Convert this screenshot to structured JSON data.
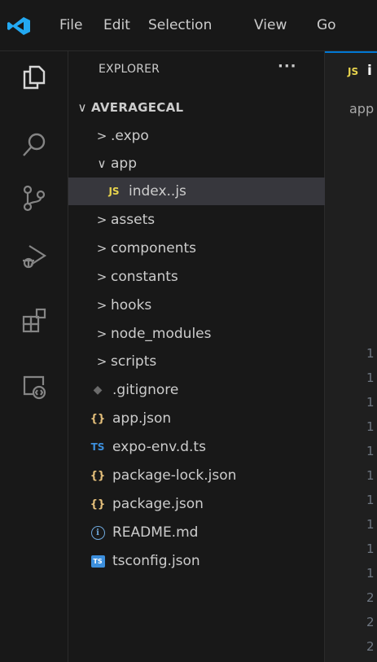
{
  "menu": {
    "items": [
      "File",
      "Edit",
      "Selection",
      "View",
      "Go"
    ]
  },
  "activity": {
    "icons": [
      "explorer-icon",
      "search-icon",
      "source-control-icon",
      "run-debug-icon",
      "extensions-icon",
      "remote-explorer-icon"
    ]
  },
  "sidebar": {
    "title": "EXPLORER",
    "more": "···",
    "root": "AVERAGECAL",
    "items": [
      {
        "label": ".expo",
        "type": "folder",
        "state": "collapsed"
      },
      {
        "label": "app",
        "type": "folder",
        "state": "expanded"
      },
      {
        "label": "index..js",
        "type": "js",
        "badge": "JS",
        "selected": true
      },
      {
        "label": "assets",
        "type": "folder",
        "state": "collapsed"
      },
      {
        "label": "components",
        "type": "folder",
        "state": "collapsed"
      },
      {
        "label": "constants",
        "type": "folder",
        "state": "collapsed"
      },
      {
        "label": "hooks",
        "type": "folder",
        "state": "collapsed"
      },
      {
        "label": "node_modules",
        "type": "folder",
        "state": "collapsed"
      },
      {
        "label": "scripts",
        "type": "folder",
        "state": "collapsed"
      },
      {
        "label": ".gitignore",
        "type": "git",
        "badge": "◆"
      },
      {
        "label": "app.json",
        "type": "json",
        "badge": "{}"
      },
      {
        "label": "expo-env.d.ts",
        "type": "ts",
        "badge": "TS"
      },
      {
        "label": "package-lock.json",
        "type": "json",
        "badge": "{}"
      },
      {
        "label": "package.json",
        "type": "json",
        "badge": "{}"
      },
      {
        "label": "README.md",
        "type": "info",
        "badge": "i"
      },
      {
        "label": "tsconfig.json",
        "type": "tsconfig",
        "badge": "TS"
      }
    ]
  },
  "editor": {
    "tab_badge": "JS",
    "tab_label": "i",
    "breadcrumb": "app",
    "line_numbers": [
      "1",
      "1",
      "1",
      "1",
      "1",
      "1",
      "1",
      "1",
      "1",
      "1",
      "2",
      "2",
      "2"
    ]
  },
  "colors": {
    "accent": "#0078d4",
    "js_yellow": "#e8d44d",
    "json_yellow": "#e5c07b",
    "ts_blue": "#3c8fdd",
    "info_blue": "#6fa8dc",
    "selected_bg": "#37373d",
    "vscode_blue": "#23a9f2"
  }
}
